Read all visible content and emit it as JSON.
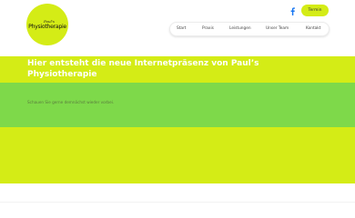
{
  "brand": {
    "logo_small": "Paul's",
    "logo_main": "Physiotherapie"
  },
  "header": {
    "social_icon": "facebook-icon",
    "cta_label": "Termin"
  },
  "nav": {
    "items": [
      {
        "label": "Start"
      },
      {
        "label": "Praxis"
      },
      {
        "label": "Leistungen"
      },
      {
        "label": "Unser Team"
      },
      {
        "label": "Kontakt"
      }
    ]
  },
  "hero": {
    "title": "Hier entsteht die neue Internetpräsenz von Paul’s Physiotherapie"
  },
  "content": {
    "text": "Schauen Sie gerne demnächst wieder vorbei."
  },
  "colors": {
    "accent_lime": "#d4ec16",
    "accent_green": "#7ed94a",
    "facebook_blue": "#1877f2"
  }
}
